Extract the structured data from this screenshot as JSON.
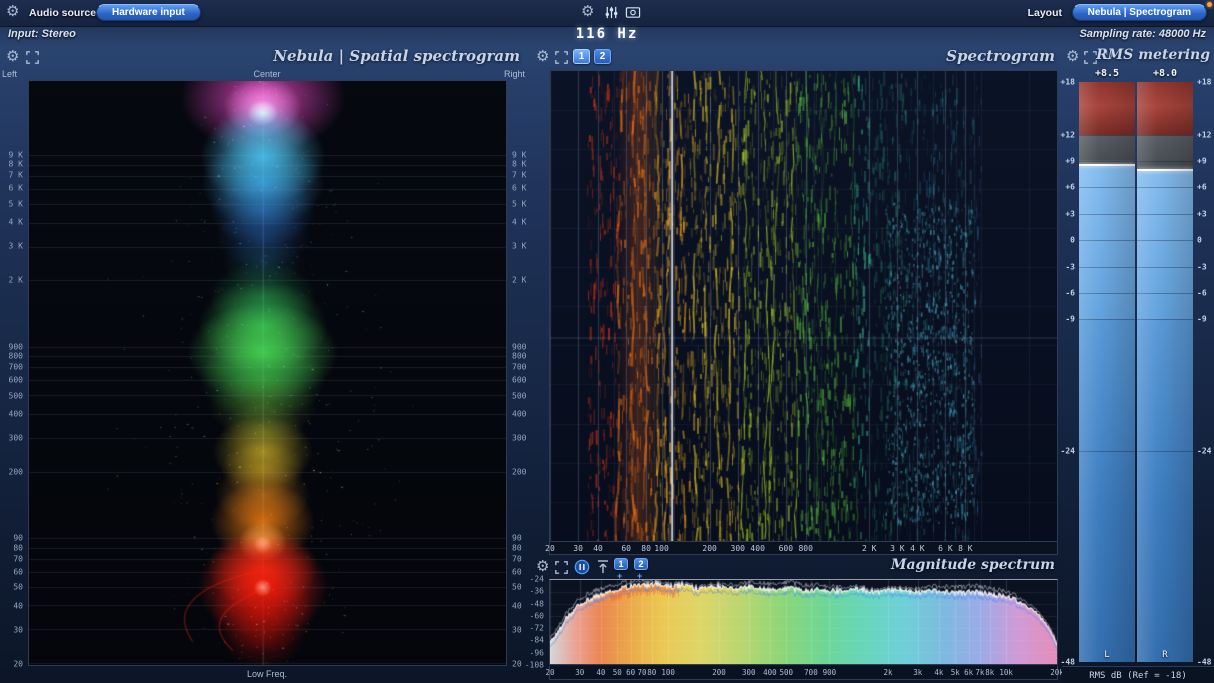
{
  "icons": {
    "gear": "⚙",
    "reset": "↻"
  },
  "topbar": {
    "audio_source_label": "Audio source",
    "hardware_input_button": "Hardware input",
    "layout_label": "Layout",
    "layout_button": "Nebula | Spectrogram",
    "input_info": "Input: Stereo",
    "frequency_readout": "116 Hz",
    "sampling_rate": "Sampling rate: 48000 Hz"
  },
  "spatial": {
    "title": "Nebula | Spatial spectrogram",
    "axis_left_label": "Left",
    "axis_center_label": "Center",
    "axis_right_label": "Right",
    "axis_bottom_label": "Low Freq.",
    "freq_ticks": [
      {
        "f": 9000,
        "label": "9 K"
      },
      {
        "f": 8000,
        "label": "8 K"
      },
      {
        "f": 7000,
        "label": "7 K"
      },
      {
        "f": 6000,
        "label": "6 K"
      },
      {
        "f": 5000,
        "label": "5 K"
      },
      {
        "f": 4000,
        "label": "4 K"
      },
      {
        "f": 3000,
        "label": "3 K"
      },
      {
        "f": 2000,
        "label": "2 K"
      },
      {
        "f": 900,
        "label": "900"
      },
      {
        "f": 800,
        "label": "800"
      },
      {
        "f": 700,
        "label": "700"
      },
      {
        "f": 600,
        "label": "600"
      },
      {
        "f": 500,
        "label": "500"
      },
      {
        "f": 400,
        "label": "400"
      },
      {
        "f": 300,
        "label": "300"
      },
      {
        "f": 200,
        "label": "200"
      },
      {
        "f": 90,
        "label": "90"
      },
      {
        "f": 80,
        "label": "80"
      },
      {
        "f": 70,
        "label": "70"
      },
      {
        "f": 60,
        "label": "60"
      },
      {
        "f": 50,
        "label": "50"
      },
      {
        "f": 40,
        "label": "40"
      },
      {
        "f": 30,
        "label": "30"
      },
      {
        "f": 20,
        "label": "20"
      }
    ]
  },
  "spectrogram": {
    "title": "Spectrogram",
    "view_buttons": [
      "1",
      "2"
    ],
    "cursor_hz": 116,
    "freq_ticks": [
      {
        "f": 20,
        "label": "20"
      },
      {
        "f": 30,
        "label": "30"
      },
      {
        "f": 40,
        "label": "40"
      },
      {
        "f": 60,
        "label": "60"
      },
      {
        "f": 80,
        "label": "80"
      },
      {
        "f": 100,
        "label": "100"
      },
      {
        "f": 200,
        "label": "200"
      },
      {
        "f": 300,
        "label": "300"
      },
      {
        "f": 400,
        "label": "400"
      },
      {
        "f": 600,
        "label": "600"
      },
      {
        "f": 800,
        "label": "800"
      },
      {
        "f": 2000,
        "label": "2 K"
      },
      {
        "f": 3000,
        "label": "3 K"
      },
      {
        "f": 4000,
        "label": "4 K"
      },
      {
        "f": 6000,
        "label": "6 K"
      },
      {
        "f": 8000,
        "label": "8 K"
      }
    ]
  },
  "magnitude": {
    "title": "Magnitude spectrum",
    "view_buttons": [
      "1",
      "2"
    ],
    "add_button_label": "+",
    "db_ticks": [
      "-24",
      "-36",
      "-48",
      "-60",
      "-72",
      "-84",
      "-96",
      "-108"
    ],
    "freq_ticks": [
      {
        "f": 20,
        "label": "20"
      },
      {
        "f": 30,
        "label": "30"
      },
      {
        "f": 40,
        "label": "40"
      },
      {
        "f": 50,
        "label": "50"
      },
      {
        "f": 60,
        "label": "60"
      },
      {
        "f": 70,
        "label": "70"
      },
      {
        "f": 80,
        "label": "80"
      },
      {
        "f": 100,
        "label": "100"
      },
      {
        "f": 200,
        "label": "200"
      },
      {
        "f": 300,
        "label": "300"
      },
      {
        "f": 400,
        "label": "400"
      },
      {
        "f": 500,
        "label": "500"
      },
      {
        "f": 700,
        "label": "700"
      },
      {
        "f": 900,
        "label": "900"
      },
      {
        "f": 2000,
        "label": "2k"
      },
      {
        "f": 3000,
        "label": "3k"
      },
      {
        "f": 4000,
        "label": "4k"
      },
      {
        "f": 5000,
        "label": "5k"
      },
      {
        "f": 6000,
        "label": "6k"
      },
      {
        "f": 7000,
        "label": "7k"
      },
      {
        "f": 8000,
        "label": "8k"
      },
      {
        "f": 10000,
        "label": "10k"
      },
      {
        "f": 20000,
        "label": "20k"
      }
    ]
  },
  "rms": {
    "title": "RMS metering",
    "left_value": "+8.5",
    "right_value": "+8.0",
    "left_channel_label": "L",
    "right_channel_label": "R",
    "footer": "RMS dB (Ref = -18)",
    "scale_max": 18,
    "scale_min": -48,
    "red_zone_bottom": 12,
    "blue_split": -9,
    "scale_ticks": [
      {
        "v": 18,
        "label": "+18"
      },
      {
        "v": 12,
        "label": "+12"
      },
      {
        "v": 9,
        "label": "+9"
      },
      {
        "v": 6,
        "label": "+6"
      },
      {
        "v": 3,
        "label": "+3"
      },
      {
        "v": 0,
        "label": "0"
      },
      {
        "v": -3,
        "label": "-3"
      },
      {
        "v": -6,
        "label": "-6"
      },
      {
        "v": -9,
        "label": "-9"
      },
      {
        "v": -24,
        "label": "-24"
      },
      {
        "v": -48,
        "label": "-48"
      }
    ]
  }
}
